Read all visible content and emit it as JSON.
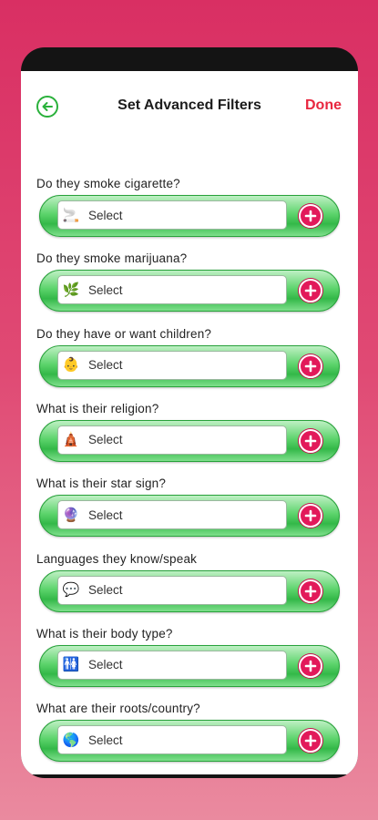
{
  "header": {
    "title": "Set Advanced Filters",
    "done_label": "Done"
  },
  "filters": [
    {
      "question": "Do they smoke cigarette?",
      "value": "Select",
      "icon": "cigarette-icon",
      "emoji": "🚬"
    },
    {
      "question": "Do they smoke marijuana?",
      "value": "Select",
      "icon": "cannabis-leaf-icon",
      "emoji": "🌿"
    },
    {
      "question": "Do they have or want children?",
      "value": "Select",
      "icon": "baby-icon",
      "emoji": "👶"
    },
    {
      "question": "What is their religion?",
      "value": "Select",
      "icon": "temple-icon",
      "emoji": "🛕"
    },
    {
      "question": "What is their star sign?",
      "value": "Select",
      "icon": "crystal-ball-icon",
      "emoji": "🔮"
    },
    {
      "question": "Languages they know/speak",
      "value": "Select",
      "icon": "languages-icon",
      "emoji": "💬"
    },
    {
      "question": "What is their body type?",
      "value": "Select",
      "icon": "body-types-icon",
      "emoji": "🚻"
    },
    {
      "question": "What are their roots/country?",
      "value": "Select",
      "icon": "globe-icon",
      "emoji": "🌎"
    }
  ],
  "colors": {
    "accent_green": "#2ab13b",
    "done_red": "#e8273f",
    "plus_pink": "#e2195a",
    "background_pink": "#d92f63"
  }
}
